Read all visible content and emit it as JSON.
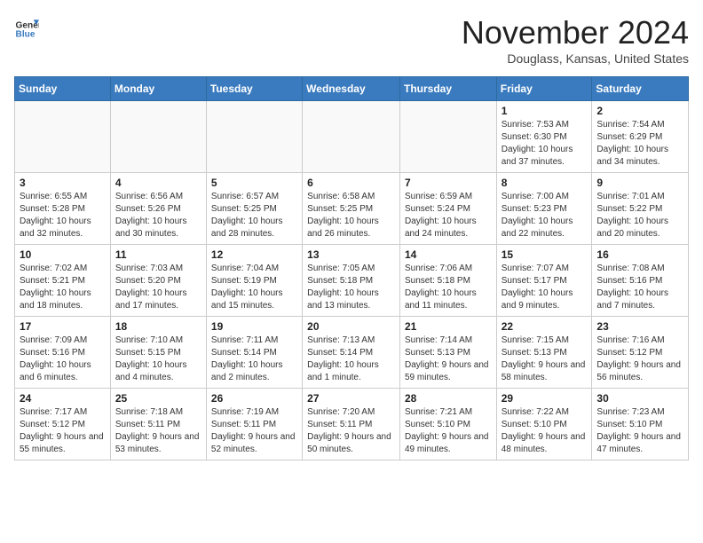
{
  "header": {
    "logo_line1": "General",
    "logo_line2": "Blue",
    "month": "November 2024",
    "location": "Douglass, Kansas, United States"
  },
  "weekdays": [
    "Sunday",
    "Monday",
    "Tuesday",
    "Wednesday",
    "Thursday",
    "Friday",
    "Saturday"
  ],
  "weeks": [
    [
      {
        "day": "",
        "info": ""
      },
      {
        "day": "",
        "info": ""
      },
      {
        "day": "",
        "info": ""
      },
      {
        "day": "",
        "info": ""
      },
      {
        "day": "",
        "info": ""
      },
      {
        "day": "1",
        "info": "Sunrise: 7:53 AM\nSunset: 6:30 PM\nDaylight: 10 hours and 37 minutes."
      },
      {
        "day": "2",
        "info": "Sunrise: 7:54 AM\nSunset: 6:29 PM\nDaylight: 10 hours and 34 minutes."
      }
    ],
    [
      {
        "day": "3",
        "info": "Sunrise: 6:55 AM\nSunset: 5:28 PM\nDaylight: 10 hours and 32 minutes."
      },
      {
        "day": "4",
        "info": "Sunrise: 6:56 AM\nSunset: 5:26 PM\nDaylight: 10 hours and 30 minutes."
      },
      {
        "day": "5",
        "info": "Sunrise: 6:57 AM\nSunset: 5:25 PM\nDaylight: 10 hours and 28 minutes."
      },
      {
        "day": "6",
        "info": "Sunrise: 6:58 AM\nSunset: 5:25 PM\nDaylight: 10 hours and 26 minutes."
      },
      {
        "day": "7",
        "info": "Sunrise: 6:59 AM\nSunset: 5:24 PM\nDaylight: 10 hours and 24 minutes."
      },
      {
        "day": "8",
        "info": "Sunrise: 7:00 AM\nSunset: 5:23 PM\nDaylight: 10 hours and 22 minutes."
      },
      {
        "day": "9",
        "info": "Sunrise: 7:01 AM\nSunset: 5:22 PM\nDaylight: 10 hours and 20 minutes."
      }
    ],
    [
      {
        "day": "10",
        "info": "Sunrise: 7:02 AM\nSunset: 5:21 PM\nDaylight: 10 hours and 18 minutes."
      },
      {
        "day": "11",
        "info": "Sunrise: 7:03 AM\nSunset: 5:20 PM\nDaylight: 10 hours and 17 minutes."
      },
      {
        "day": "12",
        "info": "Sunrise: 7:04 AM\nSunset: 5:19 PM\nDaylight: 10 hours and 15 minutes."
      },
      {
        "day": "13",
        "info": "Sunrise: 7:05 AM\nSunset: 5:18 PM\nDaylight: 10 hours and 13 minutes."
      },
      {
        "day": "14",
        "info": "Sunrise: 7:06 AM\nSunset: 5:18 PM\nDaylight: 10 hours and 11 minutes."
      },
      {
        "day": "15",
        "info": "Sunrise: 7:07 AM\nSunset: 5:17 PM\nDaylight: 10 hours and 9 minutes."
      },
      {
        "day": "16",
        "info": "Sunrise: 7:08 AM\nSunset: 5:16 PM\nDaylight: 10 hours and 7 minutes."
      }
    ],
    [
      {
        "day": "17",
        "info": "Sunrise: 7:09 AM\nSunset: 5:16 PM\nDaylight: 10 hours and 6 minutes."
      },
      {
        "day": "18",
        "info": "Sunrise: 7:10 AM\nSunset: 5:15 PM\nDaylight: 10 hours and 4 minutes."
      },
      {
        "day": "19",
        "info": "Sunrise: 7:11 AM\nSunset: 5:14 PM\nDaylight: 10 hours and 2 minutes."
      },
      {
        "day": "20",
        "info": "Sunrise: 7:13 AM\nSunset: 5:14 PM\nDaylight: 10 hours and 1 minute."
      },
      {
        "day": "21",
        "info": "Sunrise: 7:14 AM\nSunset: 5:13 PM\nDaylight: 9 hours and 59 minutes."
      },
      {
        "day": "22",
        "info": "Sunrise: 7:15 AM\nSunset: 5:13 PM\nDaylight: 9 hours and 58 minutes."
      },
      {
        "day": "23",
        "info": "Sunrise: 7:16 AM\nSunset: 5:12 PM\nDaylight: 9 hours and 56 minutes."
      }
    ],
    [
      {
        "day": "24",
        "info": "Sunrise: 7:17 AM\nSunset: 5:12 PM\nDaylight: 9 hours and 55 minutes."
      },
      {
        "day": "25",
        "info": "Sunrise: 7:18 AM\nSunset: 5:11 PM\nDaylight: 9 hours and 53 minutes."
      },
      {
        "day": "26",
        "info": "Sunrise: 7:19 AM\nSunset: 5:11 PM\nDaylight: 9 hours and 52 minutes."
      },
      {
        "day": "27",
        "info": "Sunrise: 7:20 AM\nSunset: 5:11 PM\nDaylight: 9 hours and 50 minutes."
      },
      {
        "day": "28",
        "info": "Sunrise: 7:21 AM\nSunset: 5:10 PM\nDaylight: 9 hours and 49 minutes."
      },
      {
        "day": "29",
        "info": "Sunrise: 7:22 AM\nSunset: 5:10 PM\nDaylight: 9 hours and 48 minutes."
      },
      {
        "day": "30",
        "info": "Sunrise: 7:23 AM\nSunset: 5:10 PM\nDaylight: 9 hours and 47 minutes."
      }
    ]
  ]
}
